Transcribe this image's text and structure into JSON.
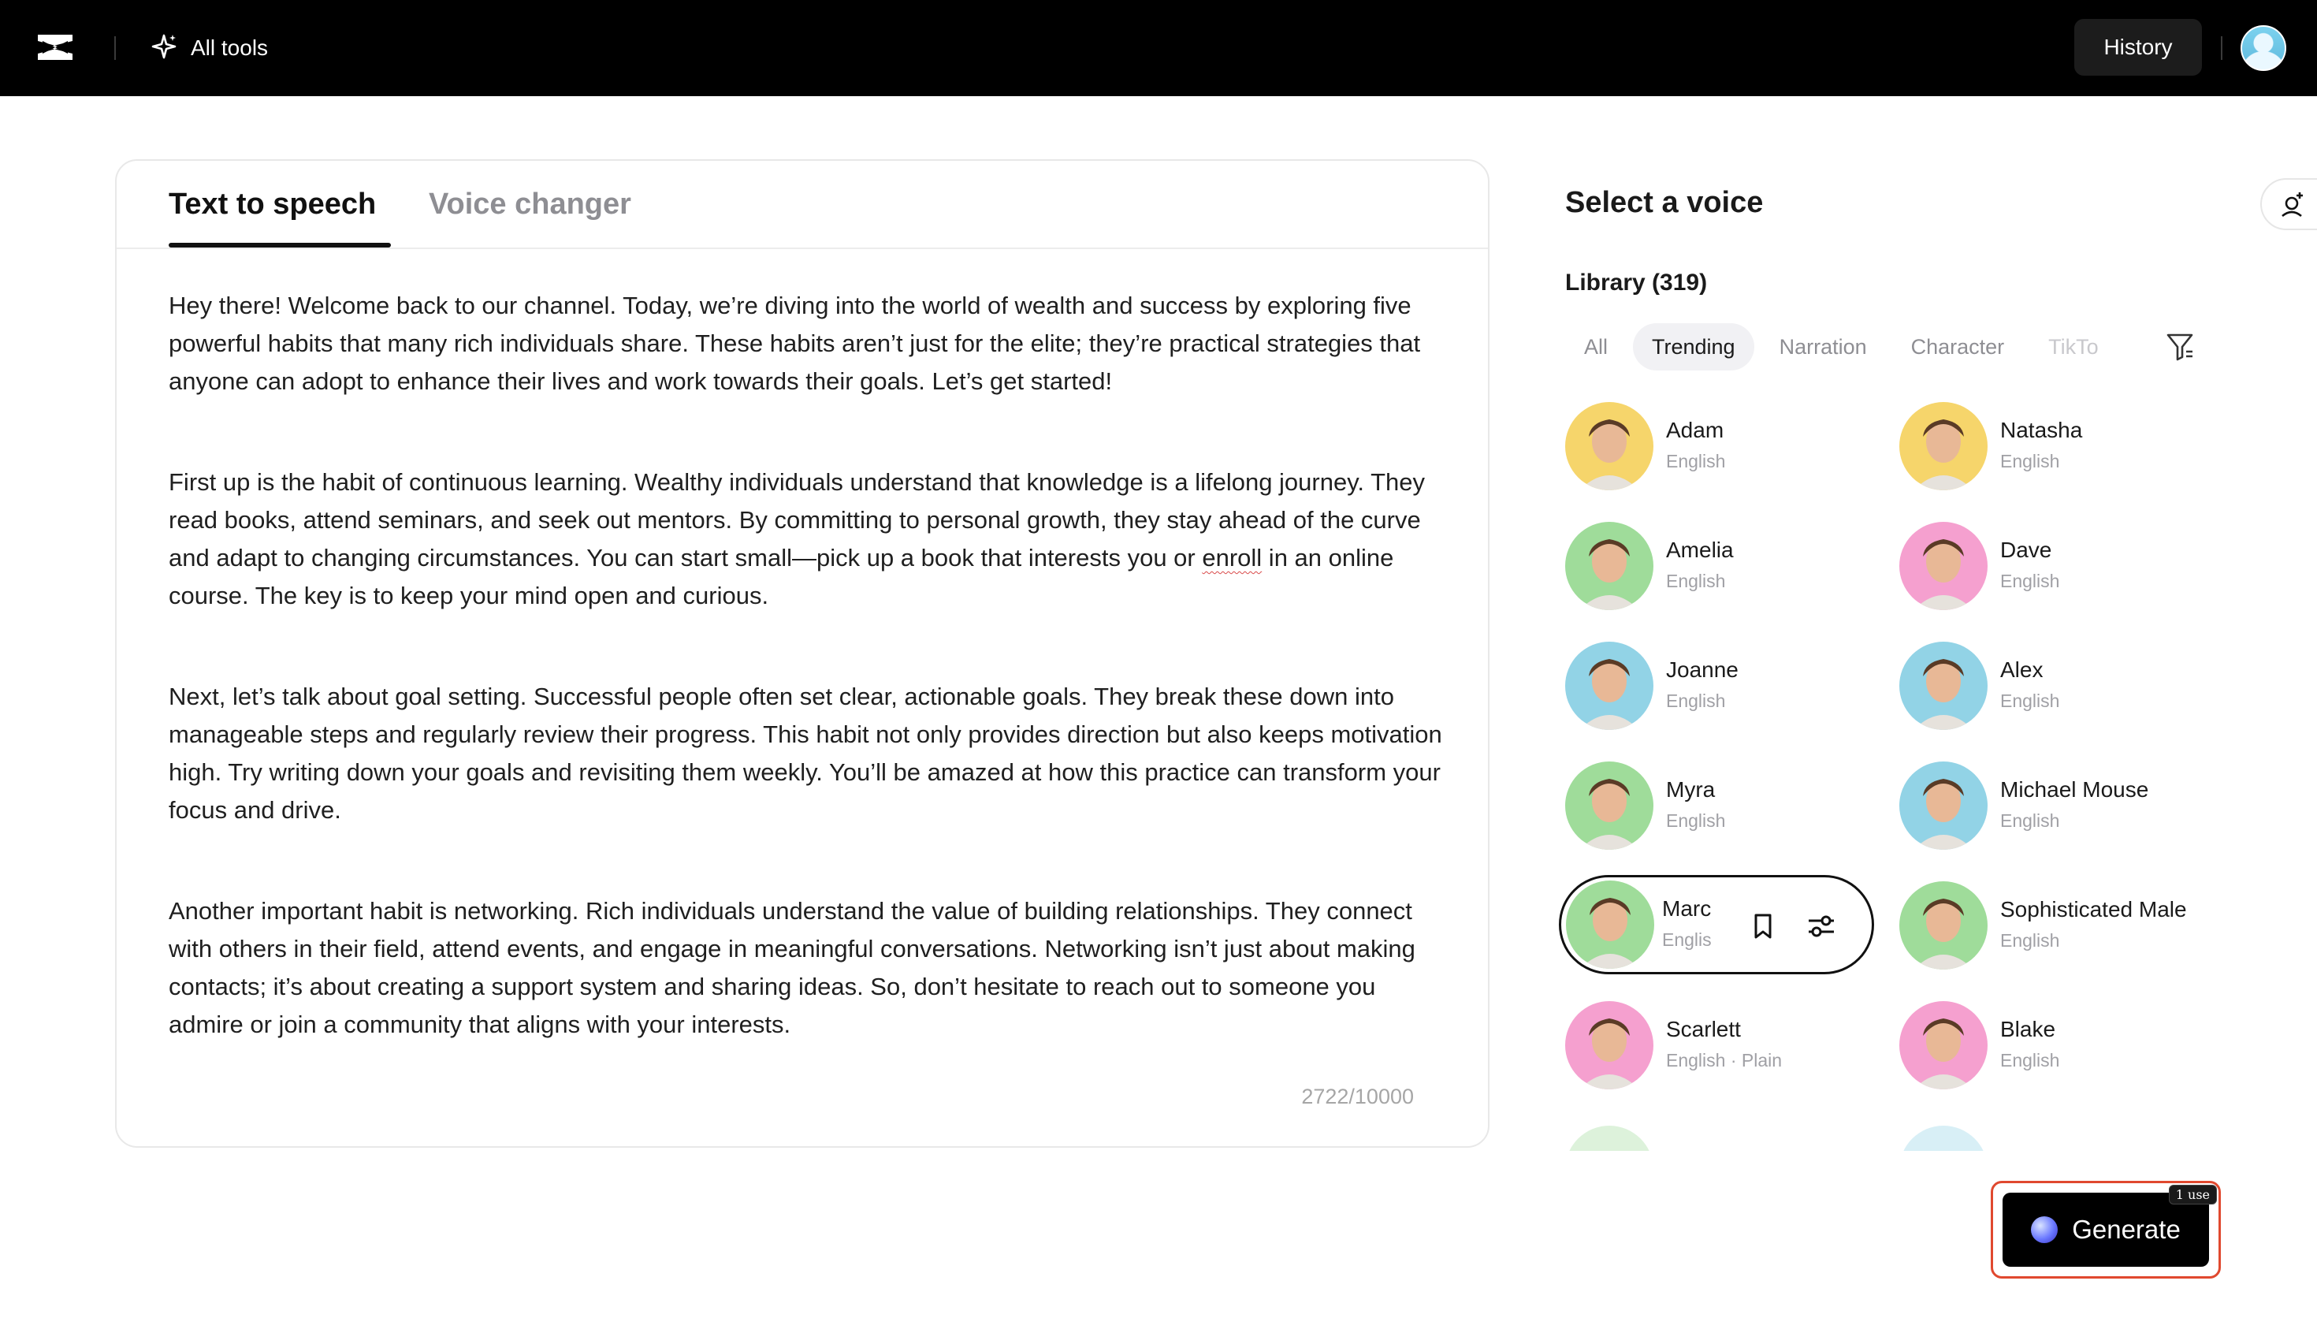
{
  "topbar": {
    "logo_icon": "capcut-logo-icon",
    "all_tools_label": "All tools",
    "history_label": "History"
  },
  "editor": {
    "tabs": [
      {
        "label": "Text to speech",
        "active": true
      },
      {
        "label": "Voice changer",
        "active": false
      }
    ],
    "paragraphs": [
      "Hey there! Welcome back to our channel. Today, we’re diving into the world of wealth and success by exploring five powerful habits that many rich individuals share. These habits aren’t just for the elite; they’re practical strategies that anyone can adopt to enhance their lives and work towards their goals. Let’s get started!",
      "First up is the habit of continuous learning. Wealthy individuals understand that knowledge is a lifelong journey. They read books, attend seminars, and seek out mentors. By committing to personal growth, they stay ahead of the curve and adapt to changing circumstances. You can start small—pick up a book that interests you or ",
      "enroll",
      " in an online course. The key is to keep your mind open and curious.",
      "Next, let’s talk about goal setting. Successful people often set clear, actionable goals. They break these down into manageable steps and regularly review their progress. This habit not only provides direction but also keeps motivation high. Try writing down your goals and revisiting them weekly. You’ll be amazed at how this practice can transform your focus and drive.",
      "Another important habit is networking. Rich individuals understand the value of building relationships. They connect with others in their field, attend events, and engage in meaningful conversations. Networking isn’t just about making contacts; it’s about creating a support system and sharing ideas. So, don’t hesitate to reach out to someone you admire or join a community that aligns with your interests."
    ],
    "char_count": "2722/10000"
  },
  "voice_panel": {
    "title": "Select a voice",
    "library_label": "Library (319)",
    "chips": [
      "All",
      "Trending",
      "Narration",
      "Character",
      "TikTo"
    ],
    "active_chip": "Trending",
    "voices": [
      {
        "name": "Adam",
        "lang": "English",
        "bg": "#f6d56b"
      },
      {
        "name": "Natasha",
        "lang": "English",
        "bg": "#f6d56b"
      },
      {
        "name": "Amelia",
        "lang": "English",
        "bg": "#9fdc9a"
      },
      {
        "name": "Dave",
        "lang": "English",
        "bg": "#f5a0cf"
      },
      {
        "name": "Joanne",
        "lang": "English",
        "bg": "#92d3e6"
      },
      {
        "name": "Alex",
        "lang": "English",
        "bg": "#92d3e6"
      },
      {
        "name": "Myra",
        "lang": "English",
        "bg": "#9fdc9a"
      },
      {
        "name": "Michael Mouse",
        "lang": "English",
        "bg": "#92d3e6"
      },
      {
        "name": "Marc",
        "lang": "Englis",
        "bg": "#9fdc9a"
      },
      {
        "name": "Sophisticated Male",
        "lang": "English",
        "bg": "#9fdc9a"
      },
      {
        "name": "Scarlett",
        "lang": "English · Plain",
        "bg": "#f5a0cf"
      },
      {
        "name": "Blake",
        "lang": "English",
        "bg": "#f5a0cf"
      }
    ],
    "selected_voice": "Marc"
  },
  "generate": {
    "label": "Generate",
    "uses_badge": "1 use",
    "highlight_color": "#e0492f"
  }
}
